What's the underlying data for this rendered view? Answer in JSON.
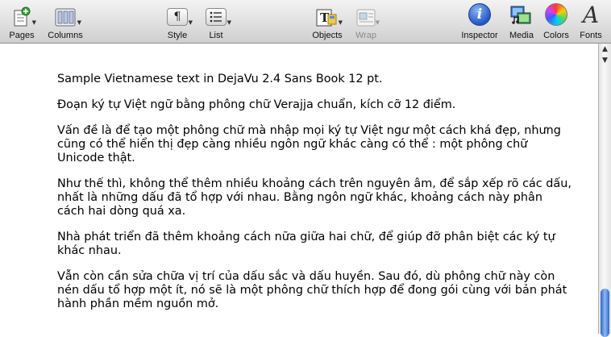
{
  "toolbar": {
    "pages": "Pages",
    "columns": "Columns",
    "style": "Style",
    "list": "List",
    "objects": "Objects",
    "wrap": "Wrap",
    "inspector": "Inspector",
    "media": "Media",
    "colors": "Colors",
    "fonts": "Fonts",
    "inspector_glyph": "i",
    "fonts_glyph": "A",
    "style_glyph": "¶",
    "objects_glyph": "T"
  },
  "document": {
    "paragraphs": [
      "Sample Vietnamese text in DejaVu 2.4 Sans Book 12 pt.",
      "Đoạn ký tự Việt ngữ bằng phông chữ Verajja chuẩn, kích cỡ 12 điểm.",
      "Vấn đề là để tạo một phông chữ mà nhập mọi ký tự Việt ngư một cách khá đẹp, nhưng cũng có thể hiển thị đẹp càng nhiều ngôn ngữ khác càng có thể : một phông chữ Unicode thật.",
      "Như thế thì, không thể thêm nhiều khoảng cách trên nguyên âm, để sắp xếp rõ các dấu, nhất là những dấu đã tổ hợp với nhau. Bằng ngôn ngữ khác, khoảng cách này phân cách hai dòng quá xa.",
      "Nhà phát triển đã thêm khoảng cách nữa giữa hai chữ, để giúp đỡ phân biệt các ký tự khác nhau.",
      "Vẫn còn cần sửa chữa vị trí của dấu sắc và dấu huyền. Sau đó, dù phông chữ này còn nén dấu tổ hợp một ít, nó sẽ là một phông chữ thích hợp để đong gói cùng với bản phát hành phần mềm nguồn mở."
    ]
  },
  "scroll_position": 0.92
}
